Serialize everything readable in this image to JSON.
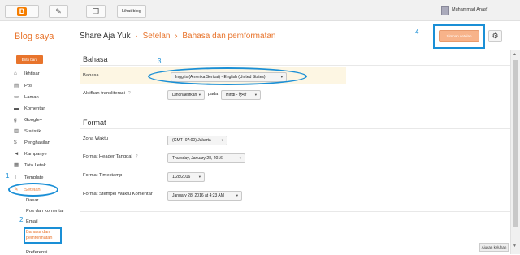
{
  "topbar": {
    "logo_letter": "B",
    "edit_icon": "pencil-icon",
    "posts_icon": "pages-icon",
    "view_blog": "Lihat blog",
    "username": "Muhammad Anas",
    "user_caret": "▾"
  },
  "header": {
    "blog_saya": "Blog saya",
    "blog_name": "Share Aja Yuk",
    "sep1": "·",
    "crumb1": "Setelan",
    "sep2": "›",
    "crumb2": "Bahasa dan pemformatan",
    "save_label": "Simpan setelan",
    "gear_icon": "⚙"
  },
  "annotations": {
    "n1": "1",
    "n2": "2",
    "n3": "3",
    "n4": "4"
  },
  "sidebar": {
    "new_post": "Entri baru",
    "items": [
      {
        "icon": "⌂",
        "label": "Ikhtisar"
      },
      {
        "icon": "▤",
        "label": "Pos"
      },
      {
        "icon": "▭",
        "label": "Laman"
      },
      {
        "icon": "▬",
        "label": "Komentar"
      },
      {
        "icon": "g",
        "label": "Google+"
      },
      {
        "icon": "▥",
        "label": "Statistik"
      },
      {
        "icon": "$",
        "label": "Penghasilan"
      },
      {
        "icon": "◄",
        "label": "Kampanye"
      },
      {
        "icon": "▦",
        "label": "Tata Letak"
      },
      {
        "icon": "T",
        "label": "Template"
      },
      {
        "icon": "✎",
        "label": "Setelan"
      }
    ],
    "sub": {
      "dasar": "Dasar",
      "pos_komentar": "Pos dan komentar",
      "email": "Email",
      "bahasa_line1": "Bahasa dan",
      "bahasa_line2": "pemformatan",
      "preferensi": "Preferensi"
    }
  },
  "bahasa": {
    "title": "Bahasa",
    "label": "Bahasa",
    "value": "Inggris (Amerika Serikat) - English (United States)",
    "translit_label": "Aktifkan transliterasi",
    "translit_value": "Dinonaktifkan",
    "pada": "pada",
    "translit_lang": "Hindi - हिन्दी",
    "help": "?"
  },
  "format": {
    "title": "Format",
    "zona_label": "Zona Waktu",
    "zona_value": "(GMT+07:00) Jakarta",
    "header_label": "Format Header Tanggal",
    "header_value": "Thursday, January 28, 2016",
    "timestamp_label": "Format Timestamp",
    "timestamp_value": "1/28/2016",
    "stempel_label": "Format Stempel Waktu Komentar",
    "stempel_value": "January 28, 2016 at 4:23 AM"
  },
  "footer": {
    "feedback": "Ajukan keluhan"
  },
  "colors": {
    "accent": "#e8742c",
    "annotation": "#1a8fd6",
    "highlight": "#fdf6e3"
  }
}
